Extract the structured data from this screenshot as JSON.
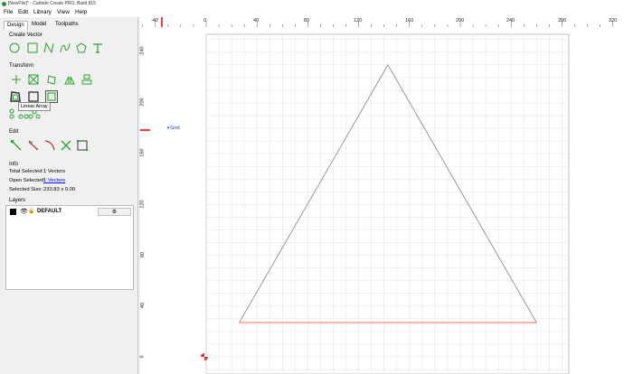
{
  "window": {
    "title": "[NewFile]* - Carbide Create PRO, Build 815"
  },
  "menu": {
    "file": "File",
    "edit": "Edit",
    "library": "Library",
    "view": "View",
    "help": "Help"
  },
  "tabs": {
    "design": "Design",
    "model": "Model",
    "toolpaths": "Toolpaths"
  },
  "sections": {
    "create_vector": "Create Vector",
    "transform": "Transform",
    "edit": "Edit",
    "info": "Info",
    "layers": "Layers"
  },
  "tooltip": "Linear Array",
  "info": {
    "total_selected_label": "Total Selected:",
    "total_selected_value": "1 Vectors",
    "open_selected_label": "Open Selected:",
    "open_selected_value": "1 Vectors",
    "selected_size_label": "Selected Size:",
    "selected_size_value": "233.83 x 0.00"
  },
  "layers": [
    {
      "name": "DEFAULT",
      "color": "#000000"
    }
  ],
  "canvas": {
    "grid_label": "Grid",
    "ruler_top_ticks": [
      "-40",
      "0",
      "40",
      "80",
      "120",
      "160",
      "200",
      "240",
      "280",
      "320"
    ],
    "ruler_left_ticks": [
      "240",
      "200",
      "160",
      "120",
      "80",
      "40",
      "0"
    ],
    "shape": {
      "apex": [
        143,
        230
      ],
      "base_left": [
        26,
        27
      ],
      "base_right": [
        260,
        27
      ]
    },
    "colors": {
      "grid": "#e6e6e6",
      "shape_line": "#808080",
      "selected_line": "#ff5a36",
      "accent": "#2aa02a"
    }
  }
}
